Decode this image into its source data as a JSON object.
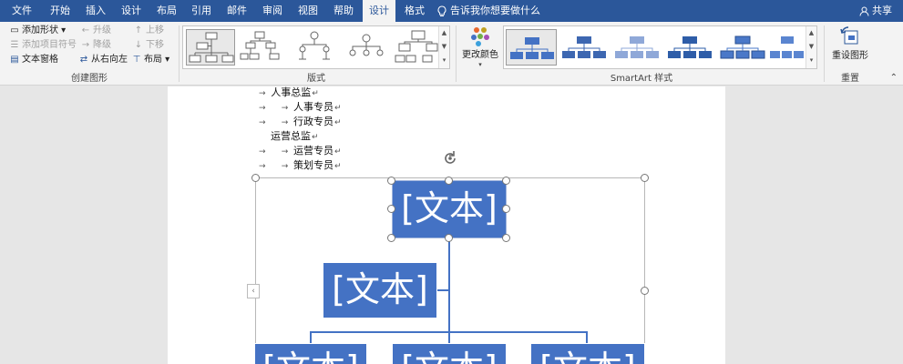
{
  "tabs": [
    "文件",
    "开始",
    "插入",
    "设计",
    "布局",
    "引用",
    "邮件",
    "审阅",
    "视图",
    "帮助",
    "设计",
    "格式"
  ],
  "active_tab_index": 10,
  "tell_me": "告诉我你想要做什么",
  "share": "共享",
  "create_graphic": {
    "add_shape": "添加形状",
    "add_bullet": "添加项目符号",
    "text_pane": "文本窗格",
    "promote": "升级",
    "demote": "降级",
    "right_to_left": "从右向左",
    "move_up": "上移",
    "move_down": "下移",
    "layout": "布局",
    "label": "创建图形"
  },
  "layouts": {
    "label": "版式"
  },
  "styles": {
    "change_colors": "更改颜色",
    "label": "SmartArt 样式"
  },
  "reset": {
    "reset_graphic": "重设图形",
    "label": "重置"
  },
  "document": {
    "lines": [
      {
        "level": 1,
        "text": "人事总监"
      },
      {
        "level": 2,
        "text": "人事专员"
      },
      {
        "level": 2,
        "text": "行政专员"
      },
      {
        "level": 0,
        "text": "运营总监"
      },
      {
        "level": 2,
        "text": "运营专员"
      },
      {
        "level": 2,
        "text": "策划专员"
      }
    ],
    "smartart_placeholder": "[文本]"
  },
  "colors": {
    "title_bar": "#2b579a",
    "smartart_fill": "#4472c4",
    "ribbon_bg": "#f3f3f3"
  }
}
